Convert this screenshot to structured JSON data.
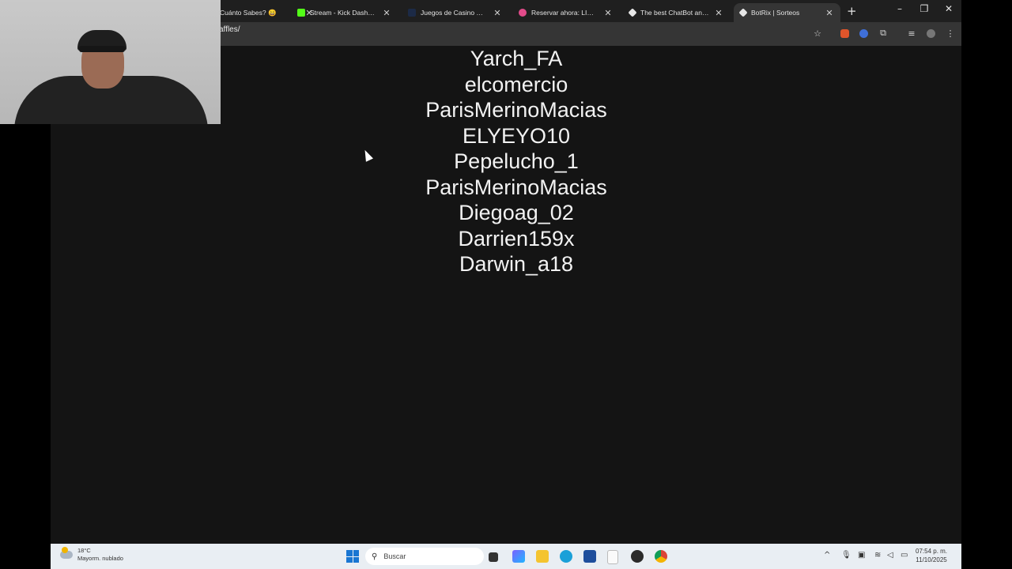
{
  "browser": {
    "tabs": [
      {
        "title": "Cuánto Sabes? 😄",
        "active": false
      },
      {
        "title": "Stream - Kick Dashboard",
        "active": false
      },
      {
        "title": "Juegos de Casino Online",
        "active": false
      },
      {
        "title": "Reservar ahora: LIM a SAL",
        "active": false
      },
      {
        "title": "The best ChatBot and Wi",
        "active": false
      },
      {
        "title": "BotRix | Sorteos",
        "active": true
      }
    ],
    "url": "affles/"
  },
  "page": {
    "names": [
      "Yarch_FA",
      "elcomercio",
      "ParisMerinoMacias",
      "ELYEYO10",
      "Pepelucho_1",
      "ParisMerinoMacias",
      "Diegoag_02",
      "Darrien159x",
      "Darwin_a18"
    ]
  },
  "taskbar": {
    "weather_temp": "18°C",
    "weather_desc": "Mayorm. nublado",
    "search_placeholder": "Buscar",
    "time": "07:54 p. m.",
    "date": "11/10/2025"
  }
}
